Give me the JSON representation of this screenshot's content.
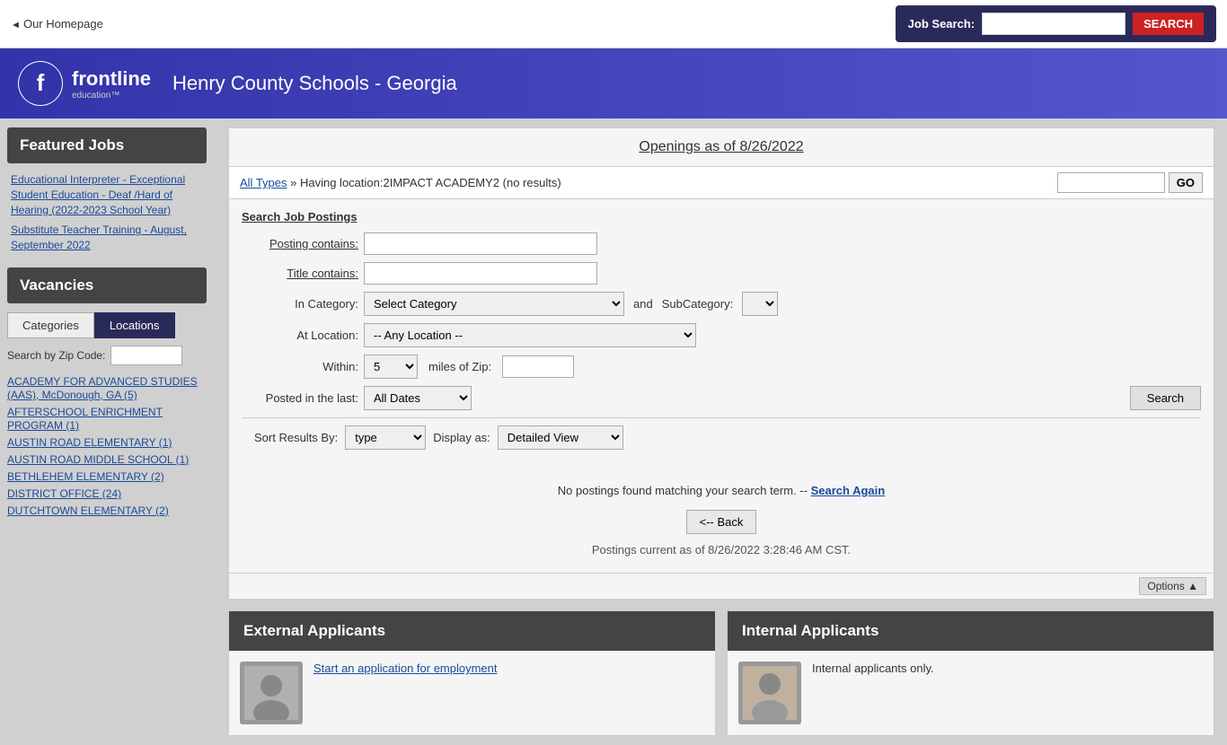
{
  "topbar": {
    "homepage_link": "Our Homepage"
  },
  "job_search_bar": {
    "label": "Job Search:",
    "placeholder": "",
    "search_button": "SEARCH"
  },
  "header": {
    "logo_letter": "f",
    "brand": "frontline",
    "brand_sub": "education™",
    "title": "Henry County Schools - Georgia"
  },
  "sidebar": {
    "featured_jobs_title": "Featured Jobs",
    "featured_jobs": [
      {
        "label": "Educational Interpreter - Exceptional Student Education - Deaf /Hard of Hearing (2022-2023 School Year)"
      },
      {
        "label": "Substitute Teacher Training - August, September 2022"
      }
    ],
    "vacancies_title": "Vacancies",
    "tabs": [
      {
        "label": "Categories",
        "active": false
      },
      {
        "label": "Locations",
        "active": true
      }
    ],
    "zip_search_label": "Search by Zip Code:",
    "zip_placeholder": "",
    "locations": [
      {
        "label": "ACADEMY FOR ADVANCED STUDIES (AAS), McDonough, GA (5)"
      },
      {
        "label": "AFTERSCHOOL ENRICHMENT PROGRAM (1)"
      },
      {
        "label": "AUSTIN ROAD ELEMENTARY (1)"
      },
      {
        "label": "AUSTIN ROAD MIDDLE SCHOOL (1)"
      },
      {
        "label": "BETHLEHEM ELEMENTARY (2)"
      },
      {
        "label": "DISTRICT OFFICE (24)"
      },
      {
        "label": "DUTCHTOWN ELEMENTARY (2)"
      }
    ]
  },
  "results": {
    "title": "Openings as of 8/26/2022",
    "breadcrumb_link": "All Types",
    "breadcrumb_text": "» Having location:2IMPACT ACADEMY2 (no results)",
    "go_button": "GO",
    "search_form_title": "Search Job Postings",
    "posting_contains_label": "Posting contains:",
    "title_contains_label": "Title contains:",
    "in_category_label": "In Category:",
    "category_options": [
      {
        "value": "",
        "label": "Select Category"
      }
    ],
    "and_text": "and",
    "subcategory_label": "SubCategory:",
    "at_location_label": "At Location:",
    "location_options": [
      {
        "value": "",
        "label": "-- Any Location --"
      }
    ],
    "within_label": "Within:",
    "within_options": [
      {
        "value": "5",
        "label": "5"
      }
    ],
    "miles_of_zip_label": "miles of Zip:",
    "posted_label": "Posted in the last:",
    "posted_options": [
      {
        "value": "all",
        "label": "All Dates"
      }
    ],
    "search_button": "Search",
    "sort_label": "Sort Results By:",
    "sort_options": [
      {
        "value": "type",
        "label": "type"
      }
    ],
    "display_label": "Display as:",
    "display_options": [
      {
        "value": "detailed",
        "label": "Detailed View"
      }
    ],
    "no_results_msg": "No postings found matching your search term. --",
    "search_again_link": "Search Again",
    "back_button": "<-- Back",
    "postings_current": "Postings current as of 8/26/2022 3:28:46 AM CST.",
    "options_button": "Options ▲"
  },
  "applicants": {
    "external_title": "External Applicants",
    "external_link": "Start an application for employment",
    "internal_title": "Internal Applicants",
    "internal_text": "Internal applicants only."
  }
}
